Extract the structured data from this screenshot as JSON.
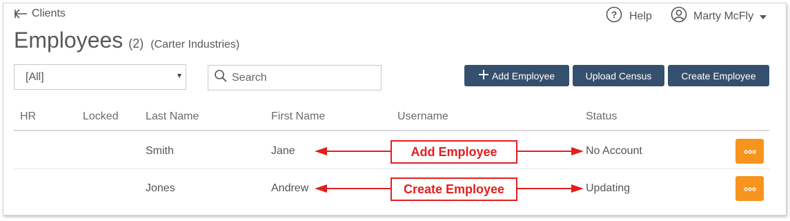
{
  "nav": {
    "back_label": "Clients",
    "help_label": "Help",
    "user_name": "Marty McFly"
  },
  "title": {
    "main": "Employees",
    "count": "(2)",
    "client": "(Carter Industries)"
  },
  "filter": {
    "selected": "[All]"
  },
  "search": {
    "placeholder": "Search",
    "value": ""
  },
  "actions": {
    "add": "Add Employee",
    "upload": "Upload Census",
    "create": "Create Employee"
  },
  "table": {
    "columns": [
      "HR",
      "Locked",
      "Last Name",
      "First Name",
      "Username",
      "Status"
    ],
    "rows": [
      {
        "hr": "",
        "locked": "",
        "last_name": "Smith",
        "first_name": "Jane",
        "username": "",
        "status": "No Account"
      },
      {
        "hr": "",
        "locked": "",
        "last_name": "Jones",
        "first_name": "Andrew",
        "username": "",
        "status": "Updating"
      }
    ]
  },
  "annotations": [
    "Add Employee",
    "Create Employee"
  ],
  "colors": {
    "primary_button": "#35506f",
    "action_button": "#f7941d",
    "annotation": "#e31e1e",
    "text": "#555555"
  },
  "icons": [
    "back-arrow-icon",
    "help-circle-icon",
    "user-circle-icon",
    "chevron-down-icon",
    "search-icon",
    "plus-icon",
    "more-dots-icon"
  ]
}
